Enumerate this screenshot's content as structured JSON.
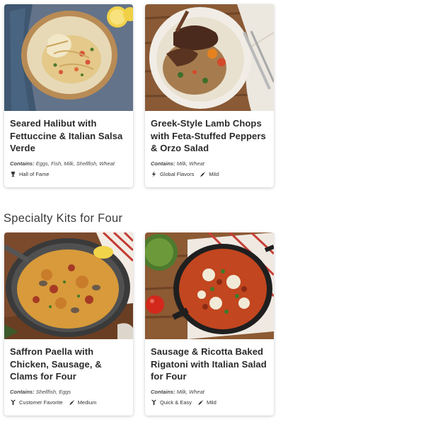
{
  "top_row": [
    {
      "title": "Seared Halibut with Fettuccine & Italian Salsa Verde",
      "contains_label": "Contains:",
      "contains": "Eggs, Fish, Milk, Shellfish, Wheat",
      "tags": [
        {
          "icon": "trophy-icon",
          "label": "Hall of Fame"
        }
      ]
    },
    {
      "title": "Greek-Style Lamb Chops with Feta-Stuffed Peppers & Orzo Salad",
      "contains_label": "Contains:",
      "contains": "Milk, Wheat",
      "tags": [
        {
          "icon": "globe-icon",
          "label": "Global Flavors"
        },
        {
          "icon": "chili-icon",
          "label": "Mild"
        }
      ]
    }
  ],
  "section": {
    "title": "Specialty Kits for Four"
  },
  "bottom_row": [
    {
      "title": "Saffron Paella with Chicken, Sausage, & Clams for Four",
      "contains_label": "Contains:",
      "contains": "Shellfish, Eggs",
      "tags": [
        {
          "icon": "favorite-icon",
          "label": "Customer Favorite"
        },
        {
          "icon": "chili-icon",
          "label": "Medium"
        }
      ]
    },
    {
      "title": "Sausage & Ricotta Baked Rigatoni with Italian Salad for Four",
      "contains_label": "Contains:",
      "contains": "Milk, Wheat",
      "tags": [
        {
          "icon": "fork-icon",
          "label": "Quick & Easy"
        },
        {
          "icon": "chili-icon",
          "label": "Mild"
        }
      ]
    }
  ]
}
